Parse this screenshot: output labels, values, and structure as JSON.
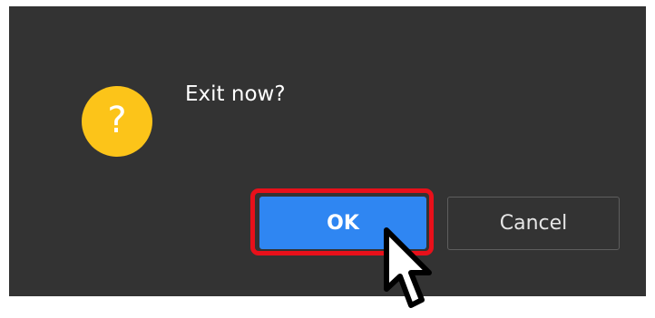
{
  "dialog": {
    "message": "Exit now?",
    "icon": "question-icon",
    "icon_glyph": "?",
    "icon_color": "#fcc419",
    "background_color": "#333333"
  },
  "buttons": {
    "ok_label": "OK",
    "cancel_label": "Cancel",
    "ok_color": "#2f86f2",
    "highlight_color": "#e8101a"
  },
  "cursor": {
    "icon": "mouse-pointer-icon"
  }
}
